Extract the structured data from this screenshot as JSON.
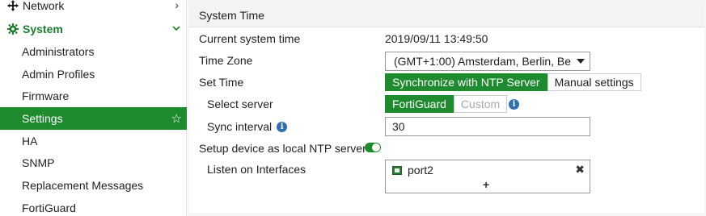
{
  "sidebar": {
    "network_label": "Network",
    "system_label": "System",
    "items": [
      {
        "label": "Administrators"
      },
      {
        "label": "Admin Profiles"
      },
      {
        "label": "Firmware"
      },
      {
        "label": "Settings"
      },
      {
        "label": "HA"
      },
      {
        "label": "SNMP"
      },
      {
        "label": "Replacement Messages"
      },
      {
        "label": "FortiGuard"
      }
    ],
    "active_item": "Settings"
  },
  "panel": {
    "title": "System Time",
    "current_time_label": "Current system time",
    "current_time_value": "2019/09/11 13:49:50",
    "timezone_label": "Time Zone",
    "timezone_value": "(GMT+1:00) Amsterdam, Berlin, Be",
    "set_time_label": "Set Time",
    "set_time_options": [
      "Synchronize with NTP Server",
      "Manual settings"
    ],
    "set_time_selected": "Synchronize with NTP Server",
    "select_server_label": "Select server",
    "server_options": [
      "FortiGuard",
      "Custom"
    ],
    "server_selected": "FortiGuard",
    "sync_interval_label": "Sync interval",
    "sync_interval_value": "30",
    "ntp_server_label": "Setup device as local NTP server",
    "ntp_server_enabled": true,
    "listen_label": "Listen on Interfaces",
    "interfaces": [
      "port2"
    ],
    "add_symbol": "+",
    "remove_symbol": "✖"
  },
  "colors": {
    "accent_green": "#1e8b2e",
    "info_blue": "#2f6fb0"
  }
}
